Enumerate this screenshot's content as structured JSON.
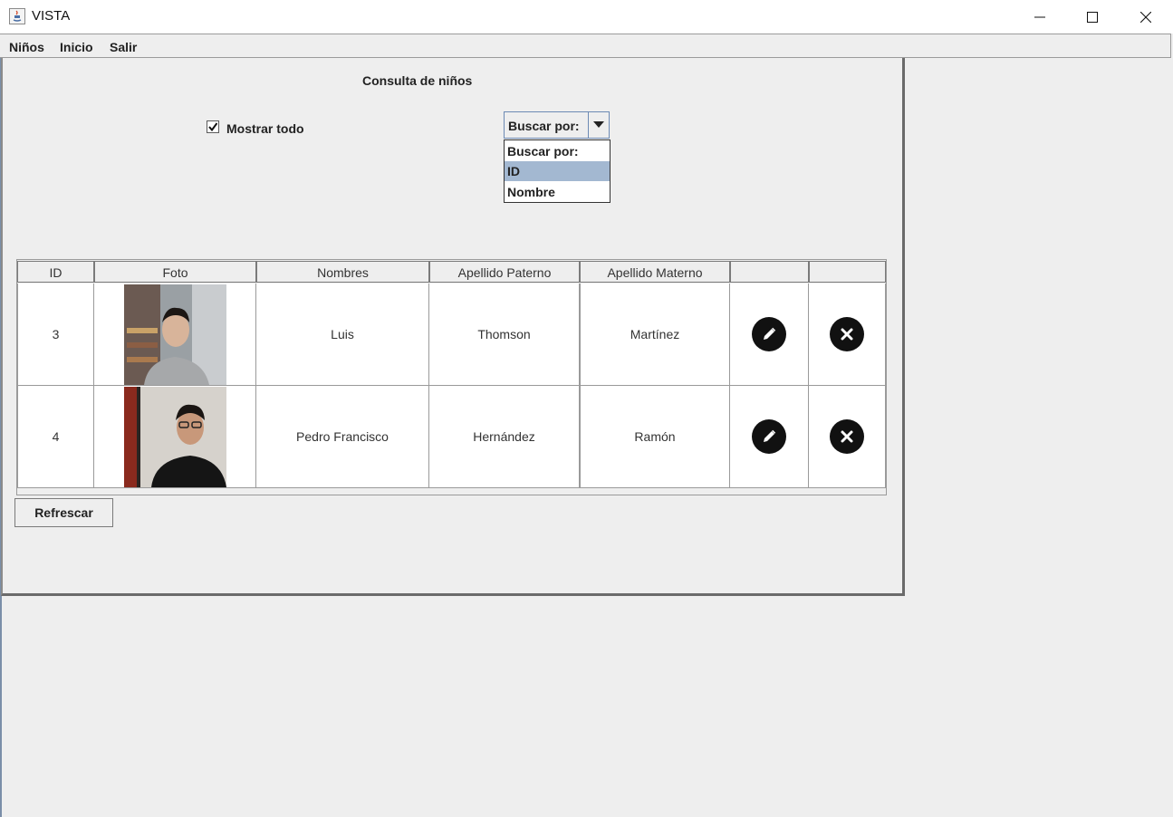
{
  "window": {
    "title": "VISTA"
  },
  "menu": {
    "items": [
      "Niños",
      "Inicio",
      "Salir"
    ]
  },
  "page": {
    "title": "Consulta de niños"
  },
  "filter": {
    "show_all_label": "Mostrar todo",
    "show_all_checked": true,
    "search_combo": {
      "selected": "Buscar por:",
      "options": [
        "Buscar por:",
        "ID",
        "Nombre"
      ],
      "highlighted": "ID"
    }
  },
  "table": {
    "columns": [
      "ID",
      "Foto",
      "Nombres",
      "Apellido Paterno",
      "Apellido Materno",
      "",
      ""
    ],
    "rows": [
      {
        "id": "3",
        "nombres": "Luis",
        "apellido_paterno": "Thomson",
        "apellido_materno": "Martínez"
      },
      {
        "id": "4",
        "nombres": "Pedro Francisco",
        "apellido_paterno": "Hernández",
        "apellido_materno": "Ramón"
      }
    ]
  },
  "actions": {
    "refresh_label": "Refrescar"
  },
  "icons": {
    "edit": "pencil-icon",
    "delete": "close-circle-icon"
  },
  "colors": {
    "selection": "#a3b8d1",
    "border_accent": "#6c8ab4"
  }
}
